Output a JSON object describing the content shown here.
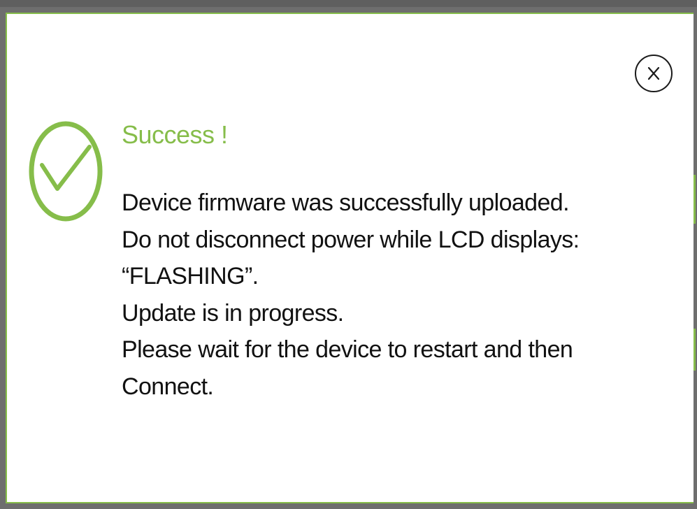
{
  "dialog": {
    "title": "Success !",
    "message_lines": [
      "Device firmware was successfully uploaded.",
      "Do not disconnect power while LCD displays:",
      "“FLASHING”.",
      "Update is in progress.",
      "Please wait for the device to restart and then",
      "Connect."
    ],
    "status_icon": "check-circle-icon",
    "close_icon": "close-icon"
  },
  "colors": {
    "accent": "#86bd4a",
    "text": "#111111",
    "background": "#ffffff",
    "backdrop": "#6e6e6e"
  }
}
